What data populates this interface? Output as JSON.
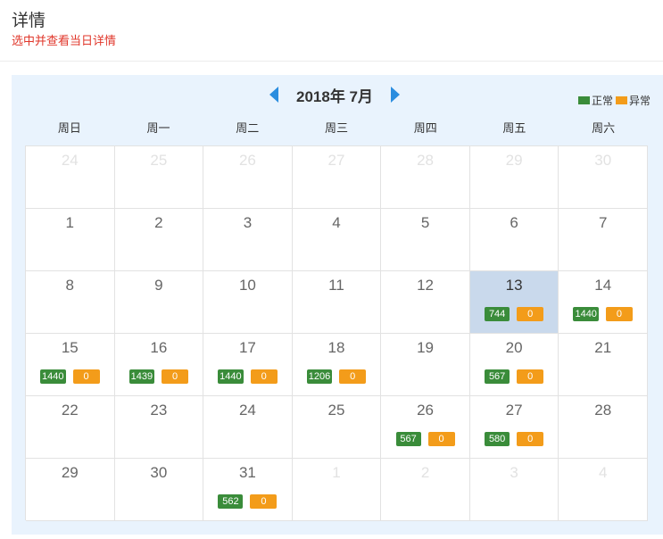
{
  "header": {
    "title": "详情",
    "subtitle": "选中并查看当日详情"
  },
  "calendar": {
    "month_title": "2018年 7月",
    "legend": {
      "normal_label": "正常",
      "abnormal_label": "异常",
      "normal_color": "#3a8c3a",
      "abnormal_color": "#f39c1a"
    },
    "prev_icon": "caret-left-icon",
    "next_icon": "caret-right-icon",
    "weekdays": [
      "周日",
      "周一",
      "周二",
      "周三",
      "周四",
      "周五",
      "周六"
    ],
    "days": [
      {
        "day": "24",
        "other": true
      },
      {
        "day": "25",
        "other": true
      },
      {
        "day": "26",
        "other": true
      },
      {
        "day": "27",
        "other": true
      },
      {
        "day": "28",
        "other": true
      },
      {
        "day": "29",
        "other": true
      },
      {
        "day": "30",
        "other": true
      },
      {
        "day": "1"
      },
      {
        "day": "2"
      },
      {
        "day": "3"
      },
      {
        "day": "4"
      },
      {
        "day": "5"
      },
      {
        "day": "6"
      },
      {
        "day": "7"
      },
      {
        "day": "8"
      },
      {
        "day": "9"
      },
      {
        "day": "10"
      },
      {
        "day": "11"
      },
      {
        "day": "12"
      },
      {
        "day": "13",
        "selected": true,
        "normal": "744",
        "abnormal": "0"
      },
      {
        "day": "14",
        "normal": "1440",
        "abnormal": "0"
      },
      {
        "day": "15",
        "normal": "1440",
        "abnormal": "0"
      },
      {
        "day": "16",
        "normal": "1439",
        "abnormal": "0"
      },
      {
        "day": "17",
        "normal": "1440",
        "abnormal": "0"
      },
      {
        "day": "18",
        "normal": "1206",
        "abnormal": "0"
      },
      {
        "day": "19"
      },
      {
        "day": "20",
        "normal": "567",
        "abnormal": "0"
      },
      {
        "day": "21"
      },
      {
        "day": "22"
      },
      {
        "day": "23"
      },
      {
        "day": "24"
      },
      {
        "day": "25"
      },
      {
        "day": "26",
        "normal": "567",
        "abnormal": "0"
      },
      {
        "day": "27",
        "normal": "580",
        "abnormal": "0"
      },
      {
        "day": "28"
      },
      {
        "day": "29"
      },
      {
        "day": "30"
      },
      {
        "day": "31",
        "normal": "562",
        "abnormal": "0"
      },
      {
        "day": "1",
        "other": true
      },
      {
        "day": "2",
        "other": true
      },
      {
        "day": "3",
        "other": true
      },
      {
        "day": "4",
        "other": true
      }
    ]
  }
}
